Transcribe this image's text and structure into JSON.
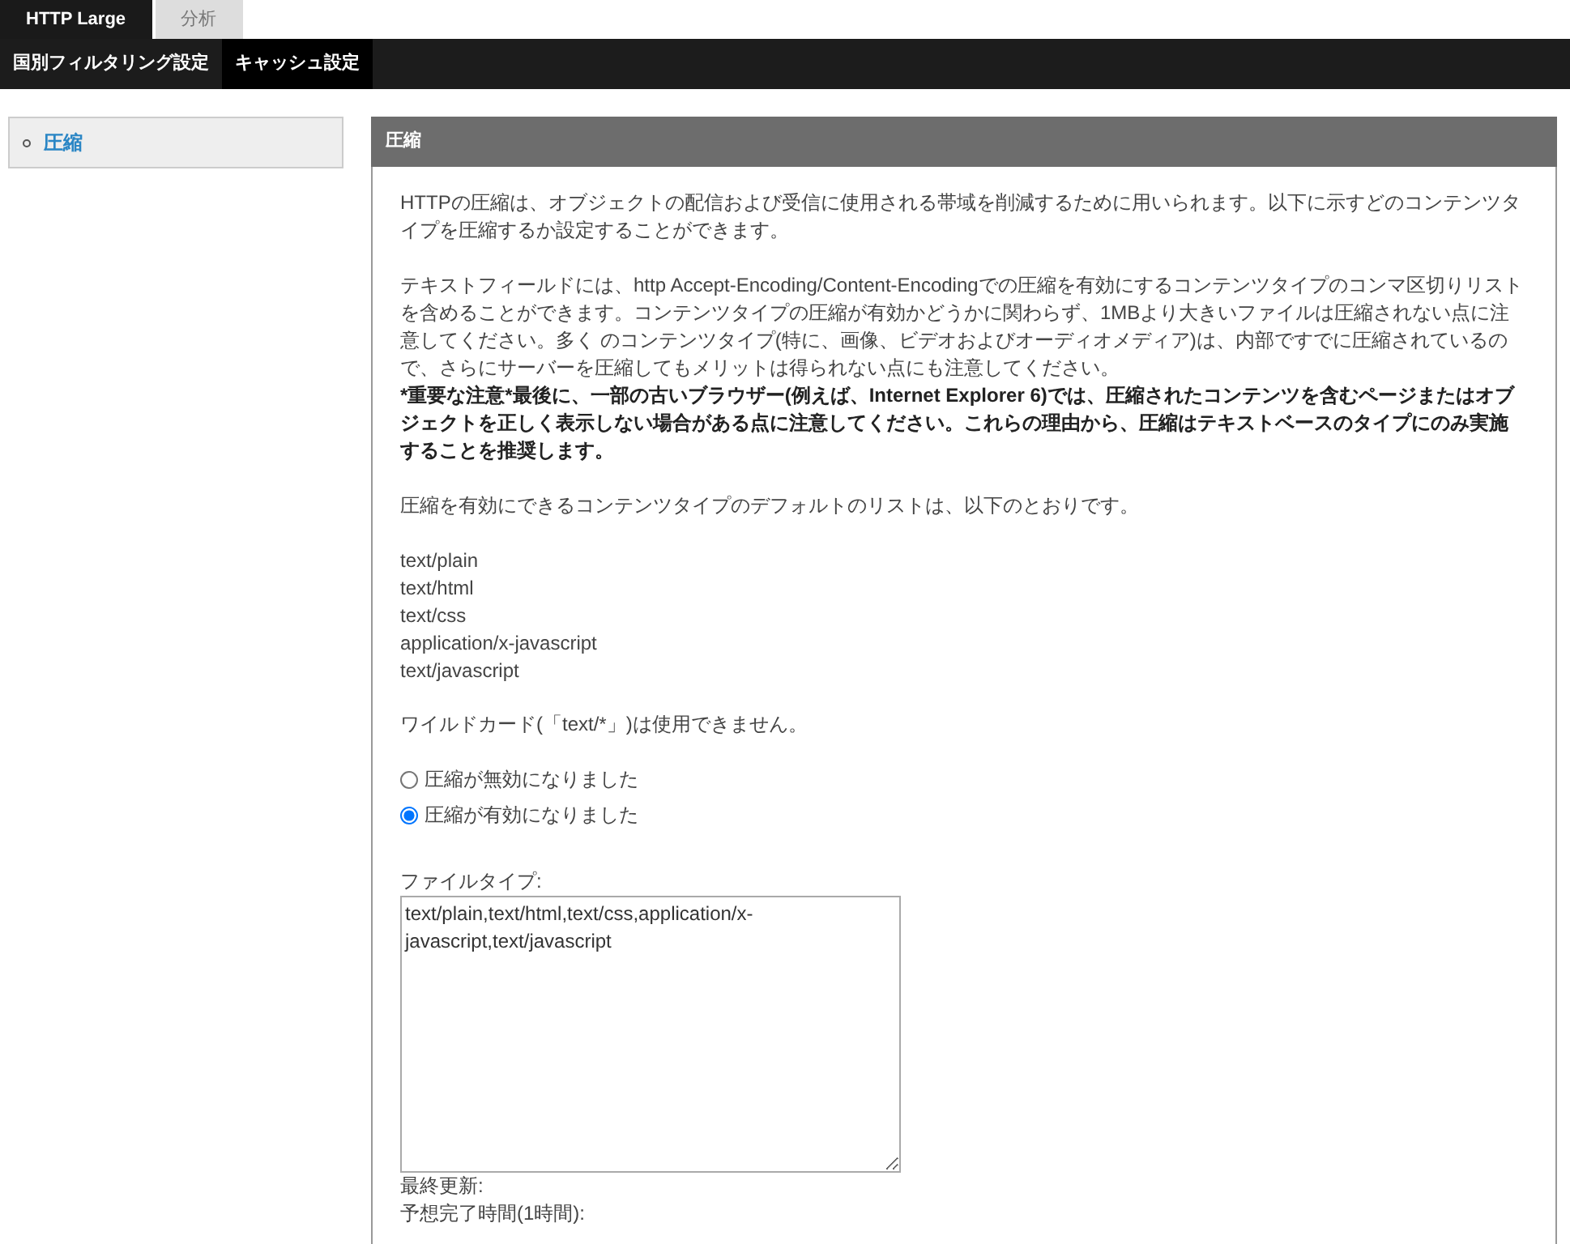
{
  "top_tabs": [
    {
      "label": "HTTP Large",
      "selected": true
    },
    {
      "label": "分析",
      "selected": false
    }
  ],
  "sub_tabs": [
    {
      "label": "国別フィルタリング設定",
      "selected": false
    },
    {
      "label": "キャッシュ設定",
      "selected": true
    }
  ],
  "sidebar": {
    "items": [
      {
        "label": "圧縮",
        "selected": true
      }
    ]
  },
  "panel": {
    "title": "圧縮",
    "paragraphs": [
      {
        "kind": "normal",
        "text": "HTTPの圧縮は、オブジェクトの配信および受信に使用される帯域を削減するために用いられます。以下に示すどのコンテンツタイプを圧縮するか設定することができます。"
      },
      {
        "kind": "normal",
        "text": "テキストフィールドには、http Accept-Encoding/Content-Encodingでの圧縮を有効にするコンテンツタイプのコンマ区切りリストを含めることができます。コンテンツタイプの圧縮が有効かどうかに関わらず、1MBより大きいファイルは圧縮されない点に注意してください。多く のコンテンツタイプ(特に、画像、ビデオおよびオーディオメディア)は、内部ですでに圧縮されているので、さらにサーバーを圧縮してもメリットは得られない点にも注意してください。"
      },
      {
        "kind": "warning",
        "text": "*重要な注意*最後に、一部の古いブラウザー(例えば、Internet Explorer 6)では、圧縮されたコンテンツを含むページまたはオブジェクトを正しく表示しない場合がある点に注意してください。これらの理由から、圧縮はテキストベースのタイプにのみ実施することを推奨します。"
      },
      {
        "kind": "normal",
        "text": "圧縮を有効にできるコンテンツタイプのデフォルトのリストは、以下のとおりです。"
      }
    ],
    "default_types": [
      "text/plain",
      "text/html",
      "text/css",
      "application/x-javascript",
      "text/javascript"
    ],
    "wildcard_note": "ワイルドカード(「text/*」)は使用できません。",
    "options": [
      {
        "label": "圧縮が無効になりました",
        "selected": false
      },
      {
        "label": "圧縮が有効になりました",
        "selected": true
      }
    ],
    "file_type": {
      "label": "ファイルタイプ:",
      "value": "text/plain,text/html,text/css,application/x-javascript,text/javascript"
    },
    "last_updated": "最終更新:",
    "estimated_time": "予想完了時間(1時間):"
  }
}
